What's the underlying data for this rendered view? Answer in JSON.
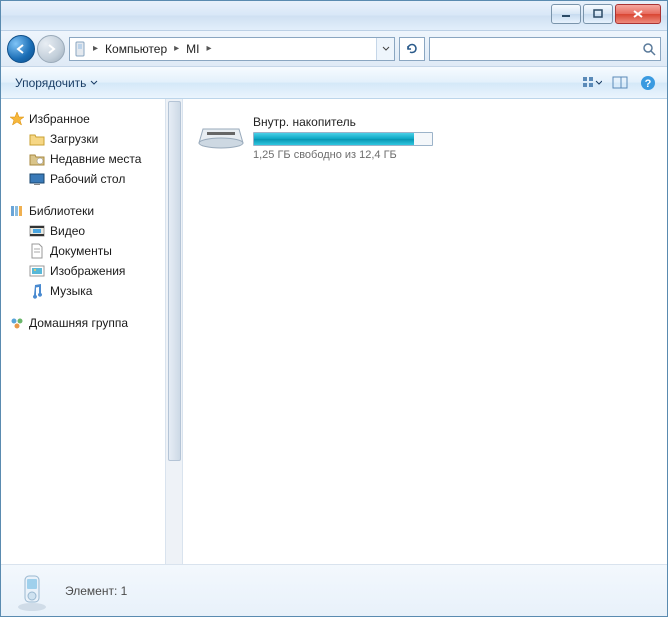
{
  "titlebar": {},
  "breadcrumb": {
    "seg1": "Компьютер",
    "seg2": "MI"
  },
  "search": {
    "placeholder": ""
  },
  "toolbar": {
    "organize": "Упорядочить"
  },
  "sidebar": {
    "favorites": {
      "head": "Избранное",
      "items": [
        "Загрузки",
        "Недавние места",
        "Рабочий стол"
      ]
    },
    "libraries": {
      "head": "Библиотеки",
      "items": [
        "Видео",
        "Документы",
        "Изображения",
        "Музыка"
      ]
    },
    "homegroup": {
      "head": "Домашняя группа"
    }
  },
  "drive": {
    "name": "Внутр. накопитель",
    "free_text": "1,25 ГБ свободно из 12,4 ГБ",
    "fill_percent": 90
  },
  "status": {
    "text": "Элемент: 1"
  }
}
